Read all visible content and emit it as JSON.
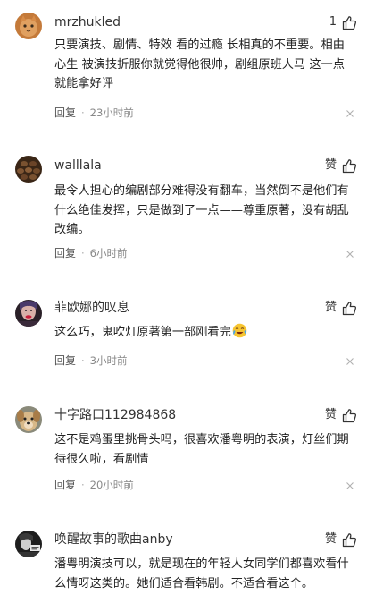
{
  "comments": [
    {
      "username": "mrzhukled",
      "like_text": "1",
      "body": "只要演技、剧情、特效 看的过瘾 长相真的不重要。相由心生 被演技折服你就觉得他很帅，剧组原班人马 这一点就能拿好评",
      "reply_label": "回复",
      "time": "23小时前",
      "avatar_icon": "orange-cat-avatar"
    },
    {
      "username": "walllala",
      "like_text": "赞",
      "body": "最令人担心的编剧部分难得没有翻车，当然倒不是他们有什么绝佳发挥，只是做到了一点——尊重原著，没有胡乱改编。",
      "reply_label": "回复",
      "time": "6小时前",
      "avatar_icon": "pinecone-avatar"
    },
    {
      "username": "菲欧娜的叹息",
      "like_text": "赞",
      "body": "这么巧，鬼吹灯原著第一部刚看完",
      "reply_label": "回复",
      "time": "3小时前",
      "avatar_icon": "red-lips-portrait-avatar",
      "emoji_icon": "crying-laughing-emoji"
    },
    {
      "username": "十字路口112984868",
      "like_text": "赞",
      "body": "这不是鸡蛋里挑骨头吗，很喜欢潘粤明的表演，灯丝们期待很久啦，看剧情",
      "reply_label": "回复",
      "time": "20小时前",
      "avatar_icon": "dog-avatar"
    },
    {
      "username": "唤醒故事的歌曲anby",
      "like_text": "赞",
      "body": "潘粤明演技可以，就是现在的年轻人女同学们都喜欢看什么情呀这类的。她们适合看韩剧。不适合看这个。",
      "avatar_icon": "bw-portrait-avatar"
    }
  ],
  "colors": {
    "text": "#222222",
    "meta": "#888888",
    "background": "#ffffff"
  }
}
